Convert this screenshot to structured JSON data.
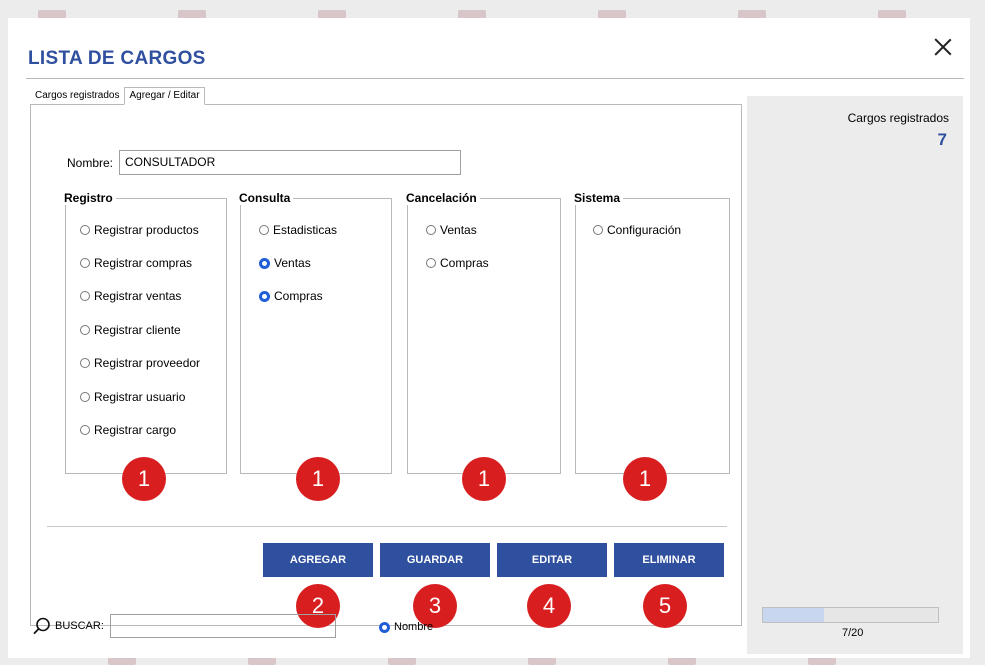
{
  "window": {
    "title": "LISTA DE CARGOS"
  },
  "tabs": [
    {
      "label": "Cargos registrados",
      "active": false
    },
    {
      "label": "Agregar / Editar",
      "active": true
    }
  ],
  "form": {
    "name_label": "Nombre:",
    "name_value": "CONSULTADOR"
  },
  "groups": [
    {
      "title": "Registro",
      "options": [
        {
          "label": "Registrar productos",
          "selected": false
        },
        {
          "label": "Registrar compras",
          "selected": false
        },
        {
          "label": "Registrar ventas",
          "selected": false
        },
        {
          "label": "Registrar cliente",
          "selected": false
        },
        {
          "label": "Registrar proveedor",
          "selected": false
        },
        {
          "label": "Registrar usuario",
          "selected": false
        },
        {
          "label": "Registrar cargo",
          "selected": false
        }
      ],
      "badge": "1"
    },
    {
      "title": "Consulta",
      "options": [
        {
          "label": "Estadisticas",
          "selected": false
        },
        {
          "label": "Ventas",
          "selected": true
        },
        {
          "label": "Compras",
          "selected": true
        }
      ],
      "badge": "1"
    },
    {
      "title": "Cancelación",
      "options": [
        {
          "label": "Ventas",
          "selected": false
        },
        {
          "label": "Compras",
          "selected": false
        }
      ],
      "badge": "1"
    },
    {
      "title": "Sistema",
      "options": [
        {
          "label": "Configuración",
          "selected": false
        }
      ],
      "badge": "1"
    }
  ],
  "buttons": [
    {
      "label": "AGREGAR",
      "badge": "2"
    },
    {
      "label": "GUARDAR",
      "badge": "3"
    },
    {
      "label": "EDITAR",
      "badge": "4"
    },
    {
      "label": "ELIMINAR",
      "badge": "5"
    }
  ],
  "sidebar": {
    "count_label": "Cargos registrados",
    "count_value": "7",
    "progress_text": "7/20",
    "progress_fraction": 0.35
  },
  "search": {
    "label": "BUSCAR:",
    "value": "",
    "filter_label": "Nombre",
    "filter_selected": true
  },
  "colors": {
    "accent": "#2f4f9f",
    "radio_selected": "#1f5ed6",
    "badge": "#d81e1e"
  },
  "icons": {
    "search": "search-icon",
    "close": "close-icon"
  }
}
